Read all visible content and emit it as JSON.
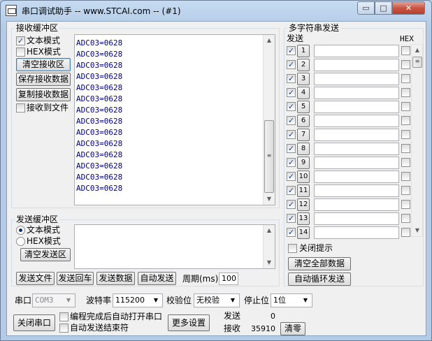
{
  "window": {
    "title": "串口调试助手 -- www.STCAI.com -- (#1)",
    "min_icon": "▭",
    "max_icon": "□",
    "close_icon": "✕"
  },
  "receive": {
    "title": "接收缓冲区",
    "text_mode": "文本模式",
    "hex_mode": "HEX模式",
    "clear_btn": "清空接收区",
    "save_btn": "保存接收数据",
    "copy_btn": "复制接收数据",
    "to_file": "接收到文件",
    "lines": [
      "ADC03=0628",
      "ADC03=0628",
      "ADC03=0628",
      "ADC03=0628",
      "ADC03=0628",
      "ADC03=0628",
      "ADC03=0628",
      "ADC03=0628",
      "ADC03=0628",
      "ADC03=0628",
      "ADC03=0628",
      "ADC03=0628",
      "ADC03=0628",
      "ADC03=0628"
    ]
  },
  "send": {
    "title": "发送缓冲区",
    "text_mode": "文本模式",
    "hex_mode": "HEX模式",
    "clear_btn": "清空发送区",
    "send_file": "发送文件",
    "send_return": "发送回车",
    "send_data": "发送数据",
    "auto_send": "自动发送",
    "period_label": "周期(ms)",
    "period_value": "100"
  },
  "multi": {
    "title": "多字符串发送",
    "send_header": "发送",
    "hex_header": "HEX",
    "rows": [
      {
        "num": "1",
        "checked": true,
        "text": "",
        "hex": false
      },
      {
        "num": "2",
        "checked": true,
        "text": "",
        "hex": false
      },
      {
        "num": "3",
        "checked": true,
        "text": "",
        "hex": false
      },
      {
        "num": "4",
        "checked": true,
        "text": "",
        "hex": false
      },
      {
        "num": "5",
        "checked": true,
        "text": "",
        "hex": false
      },
      {
        "num": "6",
        "checked": true,
        "text": "",
        "hex": false
      },
      {
        "num": "7",
        "checked": true,
        "text": "",
        "hex": false
      },
      {
        "num": "8",
        "checked": true,
        "text": "",
        "hex": false
      },
      {
        "num": "9",
        "checked": true,
        "text": "",
        "hex": false
      },
      {
        "num": "10",
        "checked": true,
        "text": "",
        "hex": false
      },
      {
        "num": "11",
        "checked": true,
        "text": "",
        "hex": false
      },
      {
        "num": "12",
        "checked": true,
        "text": "",
        "hex": false
      },
      {
        "num": "13",
        "checked": true,
        "text": "",
        "hex": false
      },
      {
        "num": "14",
        "checked": true,
        "text": "",
        "hex": false
      }
    ],
    "close_tip": "关闭提示",
    "clear_all": "清空全部数据",
    "auto_loop": "自动循环发送"
  },
  "bottom": {
    "port_label": "串口",
    "port_value": "COM3",
    "baud_label": "波特率",
    "baud_value": "115200",
    "parity_label": "校验位",
    "parity_value": "无校验",
    "stop_label": "停止位",
    "stop_value": "1位",
    "close_port": "关闭串口",
    "auto_open": "编程完成后自动打开串口",
    "auto_end": "自动发送结束符",
    "more_settings": "更多设置",
    "sent_label": "发送",
    "sent_value": "0",
    "recv_label": "接收",
    "recv_value": "35910",
    "clear_btn": "清零"
  },
  "icons": {
    "check": "✓",
    "arrow_up": "▲",
    "arrow_down": "▼"
  }
}
